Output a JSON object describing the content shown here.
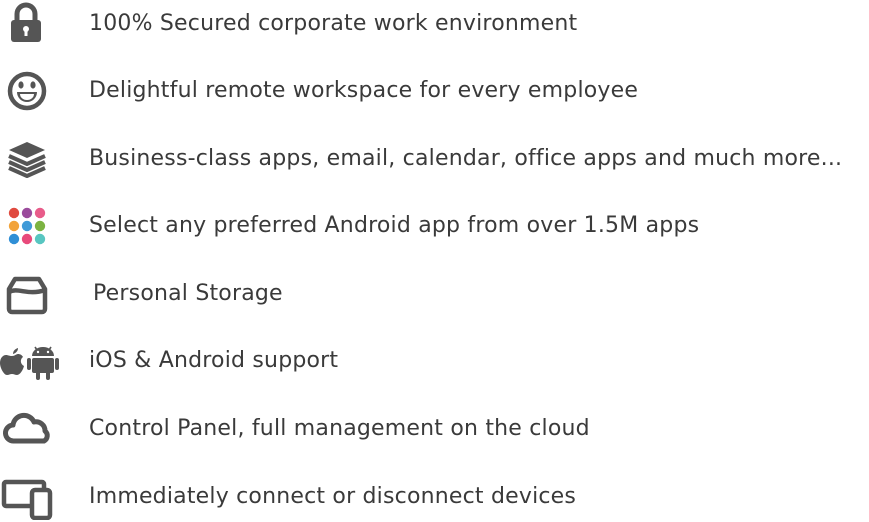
{
  "features": [
    {
      "icon": "lock-icon",
      "label": "100% Secured corporate work environment"
    },
    {
      "icon": "smiley-icon",
      "label": "Delightful remote workspace for every employee"
    },
    {
      "icon": "stack-icon",
      "label": "Business-class apps, email, calendar, office apps and much more..."
    },
    {
      "icon": "app-grid-icon",
      "label": "Select any preferred Android app from over 1.5M apps"
    },
    {
      "icon": "storage-box-icon",
      "label": "Personal Storage"
    },
    {
      "icon": "apple-android-icon",
      "label": "iOS & Android support"
    },
    {
      "icon": "cloud-icon",
      "label": "Control Panel, full management on the cloud"
    },
    {
      "icon": "devices-icon",
      "label": "Immediately connect or disconnect devices"
    }
  ],
  "colors": {
    "icon": "#555555",
    "text": "#3a3a3a",
    "dots": [
      "#e04a3f",
      "#9b4b9c",
      "#f2a33a",
      "#3f9ad8",
      "#7cb342",
      "#e85c8a",
      "#5bb8a6",
      "#c0c23a",
      "#2f8fd6",
      "#e84a7b",
      "#58c6c1",
      "#8e4f9f"
    ]
  }
}
